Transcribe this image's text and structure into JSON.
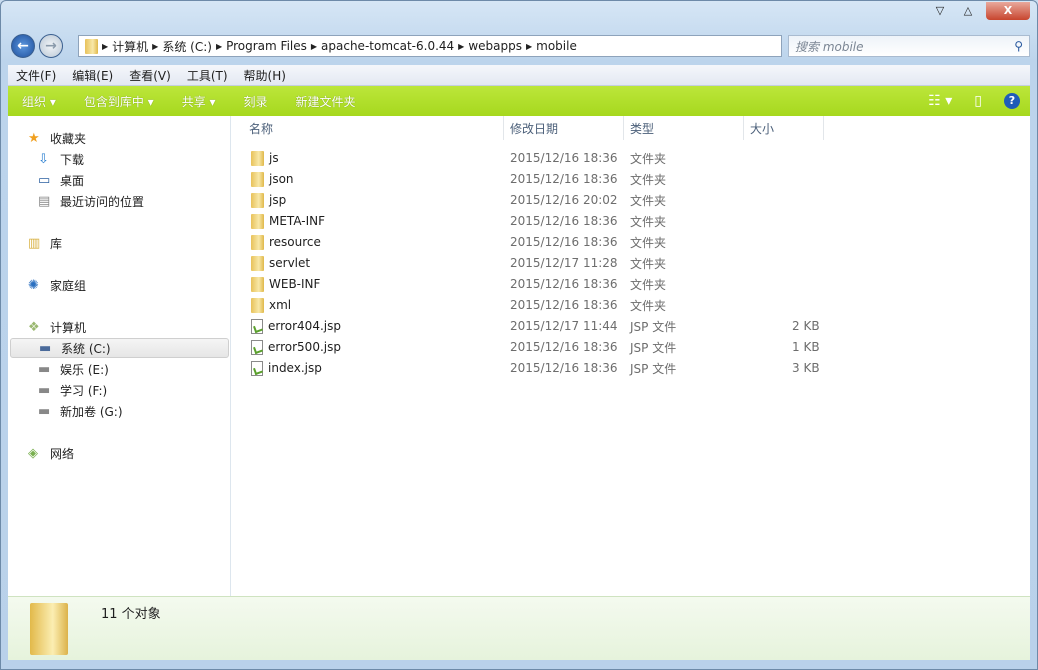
{
  "window": {
    "minimize": "▽",
    "maximize": "△",
    "close": "X"
  },
  "address": {
    "crumbs": [
      "计算机",
      "系统 (C:)",
      "Program Files",
      "apache-tomcat-6.0.44",
      "webapps",
      "mobile"
    ]
  },
  "search": {
    "placeholder": "搜索 mobile"
  },
  "menu": [
    "文件(F)",
    "编辑(E)",
    "查看(V)",
    "工具(T)",
    "帮助(H)"
  ],
  "toolbar": {
    "organize": "组织 ▾",
    "include": "包含到库中 ▾",
    "share": "共享 ▾",
    "burn": "刻录",
    "new_folder": "新建文件夹",
    "help": "?"
  },
  "sidebar": {
    "items": [
      {
        "label": "收藏夹",
        "icon": "star-icon"
      },
      {
        "label": "下载",
        "icon": "downloads-icon"
      },
      {
        "label": "桌面",
        "icon": "desktop-icon"
      },
      {
        "label": "最近访问的位置",
        "icon": "recent-places-icon"
      },
      {
        "label": "库",
        "icon": "library-icon"
      },
      {
        "label": "家庭组",
        "icon": "homegroup-icon"
      },
      {
        "label": "计算机",
        "icon": "computer-icon"
      },
      {
        "label": "系统 (C:)",
        "icon": "system-drive-icon",
        "selected": true
      },
      {
        "label": "娱乐 (E:)",
        "icon": "drive-icon"
      },
      {
        "label": "学习 (F:)",
        "icon": "drive-icon"
      },
      {
        "label": "新加卷 (G:)",
        "icon": "drive-icon"
      },
      {
        "label": "网络",
        "icon": "network-icon"
      }
    ]
  },
  "columns": [
    "名称",
    "修改日期",
    "类型",
    "大小"
  ],
  "files": [
    {
      "name": "js",
      "date": "2015/12/16 18:36",
      "type": "文件夹",
      "size": "",
      "kind": "folder"
    },
    {
      "name": "json",
      "date": "2015/12/16 18:36",
      "type": "文件夹",
      "size": "",
      "kind": "folder"
    },
    {
      "name": "jsp",
      "date": "2015/12/16 20:02",
      "type": "文件夹",
      "size": "",
      "kind": "folder"
    },
    {
      "name": "META-INF",
      "date": "2015/12/16 18:36",
      "type": "文件夹",
      "size": "",
      "kind": "folder"
    },
    {
      "name": "resource",
      "date": "2015/12/16 18:36",
      "type": "文件夹",
      "size": "",
      "kind": "folder"
    },
    {
      "name": "servlet",
      "date": "2015/12/17 11:28",
      "type": "文件夹",
      "size": "",
      "kind": "folder"
    },
    {
      "name": "WEB-INF",
      "date": "2015/12/16 18:36",
      "type": "文件夹",
      "size": "",
      "kind": "folder"
    },
    {
      "name": "xml",
      "date": "2015/12/16 18:36",
      "type": "文件夹",
      "size": "",
      "kind": "folder"
    },
    {
      "name": "error404.jsp",
      "date": "2015/12/17 11:44",
      "type": "JSP 文件",
      "size": "2 KB",
      "kind": "file"
    },
    {
      "name": "error500.jsp",
      "date": "2015/12/16 18:36",
      "type": "JSP 文件",
      "size": "1 KB",
      "kind": "file"
    },
    {
      "name": "index.jsp",
      "date": "2015/12/16 18:36",
      "type": "JSP 文件",
      "size": "3 KB",
      "kind": "file"
    }
  ],
  "status": {
    "count": "11 个对象"
  }
}
